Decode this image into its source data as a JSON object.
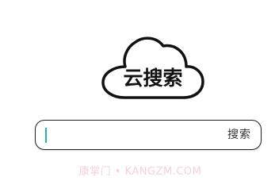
{
  "logo": {
    "text": "云搜索"
  },
  "search": {
    "placeholder": "",
    "value": "",
    "button_label": "搜索"
  },
  "watermark": {
    "text": "康掌门 • KANGZM.COM"
  },
  "colors": {
    "caret": "#1fb5a8",
    "outline": "#222222",
    "watermark": "#f3c9d7"
  }
}
